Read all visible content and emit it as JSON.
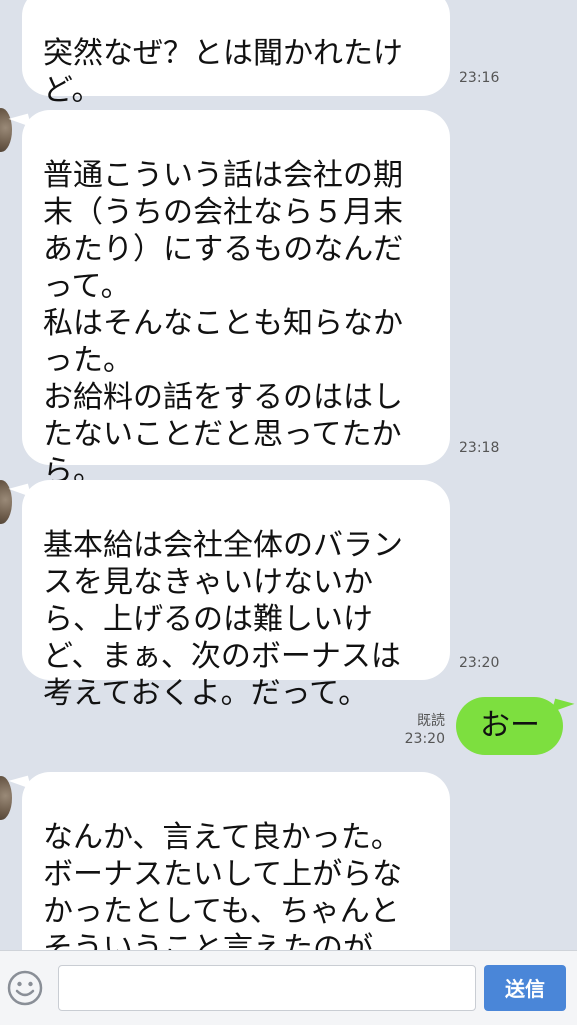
{
  "messages": [
    {
      "text": "突然なぜ？とは聞かれたけ\nど。",
      "time": "23:16"
    },
    {
      "text": "普通こういう話は会社の期\n末（うちの会社なら５月末\nあたり）にするものなんだ\nって。\n私はそんなことも知らなか\nった。\nお給料の話をするのははし\nたないことだと思ってたか\nら。",
      "time": "23:18"
    },
    {
      "text": "基本給は会社全体のバラン\nスを見なきゃいけないか\nら、上げるのは難しいけ\nど、まぁ、次のボーナスは\n考えておくよ。だって。",
      "time": "23:20"
    },
    {
      "text": "なんか、言えて良かった。\nボーナスたいして上がらな\nかったとしても、ちゃんと\nそういうこと言えたのが、\nエライ達成感あった。",
      "time": ""
    }
  ],
  "sent": {
    "text": "おー",
    "read_label": "既読",
    "time": "23:20"
  },
  "composer": {
    "placeholder": "",
    "send_label": "送信"
  },
  "colors": {
    "background": "#dce1ea",
    "sent_bubble": "#7ddf3f",
    "send_button": "#4a86d8"
  }
}
